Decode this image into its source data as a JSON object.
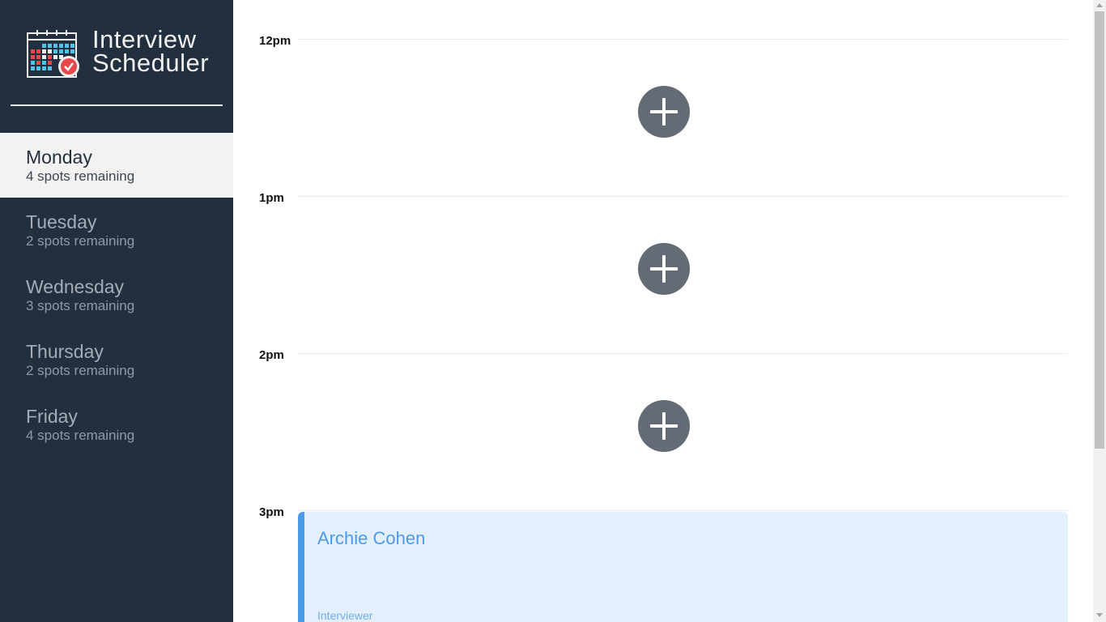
{
  "sidebar": {
    "brand": {
      "line1": "Interview",
      "line2": "Scheduler",
      "logo_icon": "calendar-check-icon"
    },
    "days": [
      {
        "name": "Monday",
        "spots": "4 spots remaining",
        "selected": true
      },
      {
        "name": "Tuesday",
        "spots": "2 spots remaining",
        "selected": false
      },
      {
        "name": "Wednesday",
        "spots": "3 spots remaining",
        "selected": false
      },
      {
        "name": "Thursday",
        "spots": "2 spots remaining",
        "selected": false
      },
      {
        "name": "Friday",
        "spots": "4 spots remaining",
        "selected": false
      }
    ]
  },
  "schedule": {
    "slots": [
      {
        "time": "12pm",
        "add_icon": "plus-icon"
      },
      {
        "time": "1pm",
        "add_icon": "plus-icon"
      },
      {
        "time": "2pm",
        "add_icon": "plus-icon"
      },
      {
        "time": "3pm"
      }
    ],
    "appointment": {
      "student": "Archie Cohen",
      "interviewer_label": "Interviewer"
    }
  },
  "colors": {
    "sidebar_bg": "#222f3e",
    "selected_day_bg": "#f2f2f2",
    "add_button": "#636b75",
    "appointment_bg": "#e3effc",
    "appointment_accent": "#4a9bea"
  }
}
